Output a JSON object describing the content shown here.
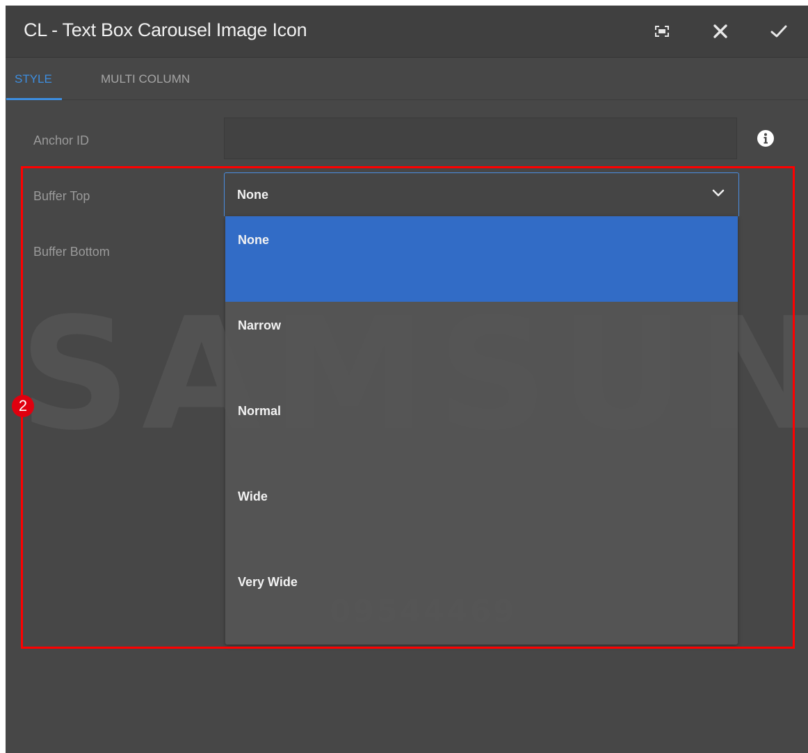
{
  "dialog": {
    "title": "CL - Text Box Carousel Image Icon"
  },
  "header_icons": [
    "fullscreen-icon",
    "close-icon",
    "checkmark-icon"
  ],
  "tabs": [
    {
      "label": "STYLE",
      "active": true
    },
    {
      "label": "MULTI COLUMN",
      "active": false
    }
  ],
  "fields": {
    "anchor_id": {
      "label": "Anchor ID",
      "value": ""
    },
    "buffer_top": {
      "label": "Buffer Top",
      "value": "None"
    },
    "buffer_bottom": {
      "label": "Buffer Bottom"
    }
  },
  "dropdown": {
    "options": [
      "None",
      "Narrow",
      "Normal",
      "Wide",
      "Very Wide"
    ],
    "selected": "None"
  },
  "watermark": {
    "brand": "SAMSUNG",
    "code": "09544469"
  },
  "annotation": {
    "step": "2",
    "color": "#ff0000"
  },
  "colors": {
    "accent": "#3d8ee0",
    "selected_option": "#326cc6",
    "background": "#474747"
  }
}
